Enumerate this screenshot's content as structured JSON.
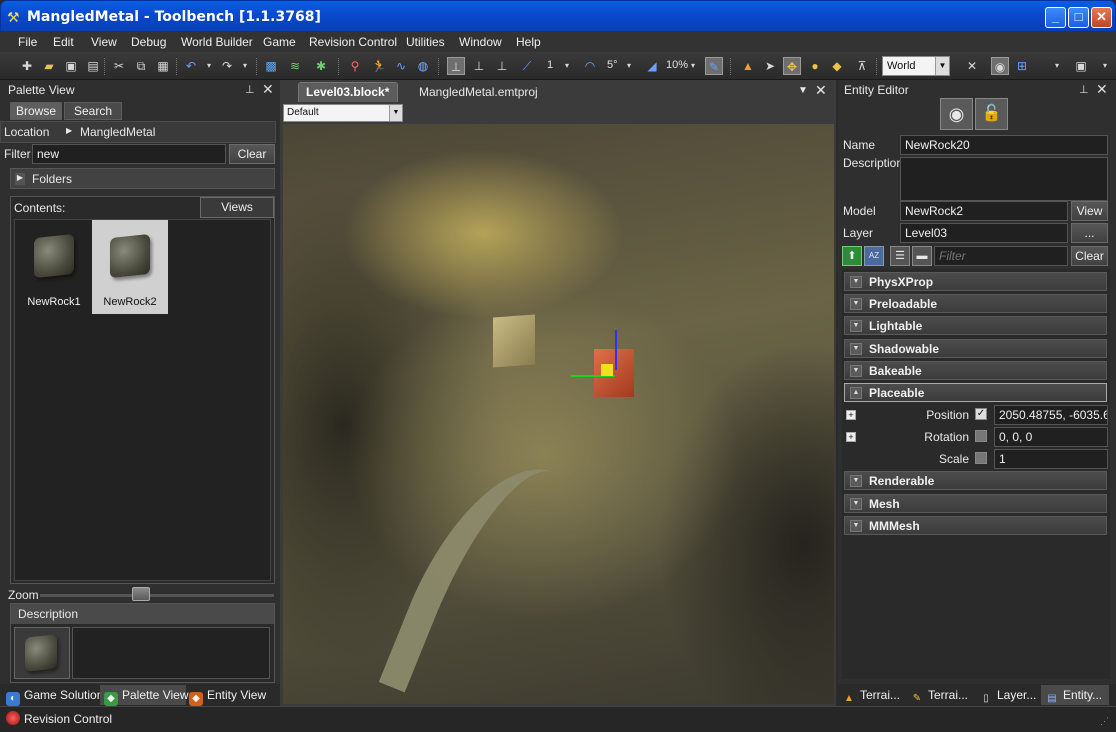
{
  "window": {
    "title": "MangledMetal - Toolbench [1.1.3768]"
  },
  "menu": [
    "File",
    "Edit",
    "View",
    "Debug",
    "World Builder",
    "Game",
    "Revision Control",
    "Utilities",
    "Window",
    "Help"
  ],
  "toolbar": {
    "snap_count": "1",
    "angle": "5°",
    "scale_pct": "10%",
    "coord_space": "World"
  },
  "palette": {
    "title": "Palette View",
    "tabs": [
      "Browse",
      "Search"
    ],
    "location_label": "Location",
    "location_value": "MangledMetal",
    "filter_label": "Filter",
    "filter_value": "new",
    "clear_label": "Clear",
    "folders_label": "Folders",
    "contents_label": "Contents:",
    "views_label": "Views",
    "items": [
      "NewRock1",
      "NewRock2"
    ],
    "zoom_label": "Zoom",
    "description_label": "Description"
  },
  "documents": {
    "tabs": [
      "Level03.block*",
      "MangledMetal.emtproj"
    ],
    "filter_select": "Default"
  },
  "entity": {
    "title": "Entity Editor",
    "name_label": "Name",
    "name_value": "NewRock20",
    "description_label": "Description",
    "model_label": "Model",
    "model_value": "NewRock2",
    "view_label": "View",
    "layer_label": "Layer",
    "layer_value": "Level03",
    "browse_label": "...",
    "filter_placeholder": "Filter",
    "clear_label": "Clear",
    "sections_top": [
      "PhysXProp",
      "Preloadable",
      "Lightable",
      "Shadowable",
      "Bakeable",
      "Placeable"
    ],
    "placeable": {
      "position_label": "Position",
      "position_value": "2050.48755, -6035.6(",
      "rotation_label": "Rotation",
      "rotation_value": "0, 0, 0",
      "scale_label": "Scale",
      "scale_value": "1"
    },
    "sections_bottom": [
      "Renderable",
      "Mesh",
      "MMMesh"
    ]
  },
  "bottom_left_tabs": [
    "Game Solution",
    "Palette View",
    "Entity View"
  ],
  "bottom_right_tabs": [
    "Terrai...",
    "Terrai...",
    "Layer...",
    "Entity..."
  ],
  "status": {
    "revision_control": "Revision Control"
  }
}
